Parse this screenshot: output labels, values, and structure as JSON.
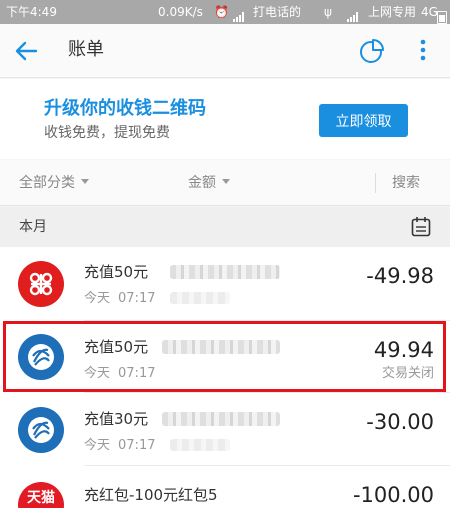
{
  "status_bar": {
    "time": "下午4:49",
    "speed": "0.09K/s",
    "carrier1": "打电话的",
    "carrier2": "上网专用",
    "network": "4G"
  },
  "app_bar": {
    "title": "账单"
  },
  "promo": {
    "title": "升级你的收钱二维码",
    "subtitle": "收钱免费，提现免费",
    "button": "立即领取"
  },
  "filters": {
    "category": "全部分类",
    "amount": "金额",
    "search": "搜索"
  },
  "section": {
    "label": "本月"
  },
  "transactions": [
    {
      "name": "充值50元",
      "day": "今天",
      "time": "07:17",
      "amount": "-49.98",
      "status": "",
      "icon": "china-unicom-icon",
      "icon_color": "#e01e1e"
    },
    {
      "name": "充值50元",
      "day": "今天",
      "time": "07:17",
      "amount": "49.94",
      "status": "交易关闭",
      "icon": "china-mobile-icon",
      "icon_color": "#1e6fb8"
    },
    {
      "name": "充值30元",
      "day": "今天",
      "time": "07:17",
      "amount": "-30.00",
      "status": "",
      "icon": "china-mobile-icon",
      "icon_color": "#1e6fb8"
    },
    {
      "name": "充红包-100元红包5",
      "day": "",
      "time": "",
      "amount": "-100.00",
      "status": "",
      "icon": "tmall-icon",
      "icon_label": "天猫",
      "icon_color": "#e21a23"
    }
  ],
  "colors": {
    "accent": "#1a8fe0",
    "highlight": "#e3141c"
  }
}
